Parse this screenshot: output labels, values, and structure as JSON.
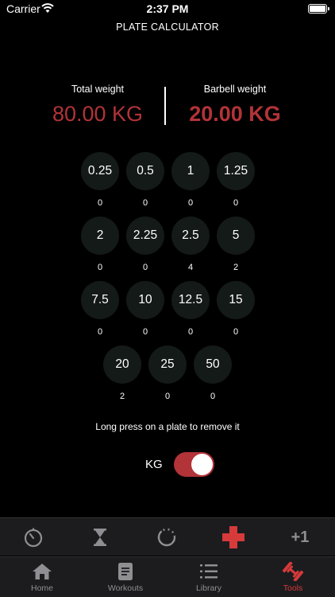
{
  "status_bar": {
    "carrier": "Carrier",
    "time": "2:37 PM"
  },
  "nav": {
    "title": "PLATE CALCULATOR"
  },
  "total": {
    "label": "Total weight",
    "value": "80.00 KG"
  },
  "barbell": {
    "label": "Barbell weight",
    "value": "20.00 KG"
  },
  "plates": [
    {
      "weight": "0.25",
      "count": "0"
    },
    {
      "weight": "0.5",
      "count": "0"
    },
    {
      "weight": "1",
      "count": "0"
    },
    {
      "weight": "1.25",
      "count": "0"
    },
    {
      "weight": "2",
      "count": "0"
    },
    {
      "weight": "2.25",
      "count": "0"
    },
    {
      "weight": "2.5",
      "count": "4"
    },
    {
      "weight": "5",
      "count": "2"
    },
    {
      "weight": "7.5",
      "count": "0"
    },
    {
      "weight": "10",
      "count": "0"
    },
    {
      "weight": "12.5",
      "count": "0"
    },
    {
      "weight": "15",
      "count": "0"
    },
    {
      "weight": "20",
      "count": "2"
    },
    {
      "weight": "25",
      "count": "0"
    },
    {
      "weight": "50",
      "count": "0"
    }
  ],
  "hint": "Long press on a plate to remove it",
  "unit": {
    "label": "KG",
    "enabled": true
  },
  "tools": [
    {
      "icon": "stopwatch-icon"
    },
    {
      "icon": "hourglass-icon"
    },
    {
      "icon": "circular-timer-icon"
    },
    {
      "icon": "medical-cross-icon",
      "active": true
    },
    {
      "icon": "plus-one-icon",
      "label": "+1"
    }
  ],
  "tabs": [
    {
      "label": "Home",
      "icon": "home-icon"
    },
    {
      "label": "Workouts",
      "icon": "document-icon"
    },
    {
      "label": "Library",
      "icon": "list-icon"
    },
    {
      "label": "Tools",
      "icon": "dumbbell-icon",
      "active": true
    }
  ],
  "colors": {
    "accent": "#b23338",
    "active": "#d63a3a",
    "plate_bg": "#141a18",
    "bar_bg": "#1c1c1e"
  }
}
